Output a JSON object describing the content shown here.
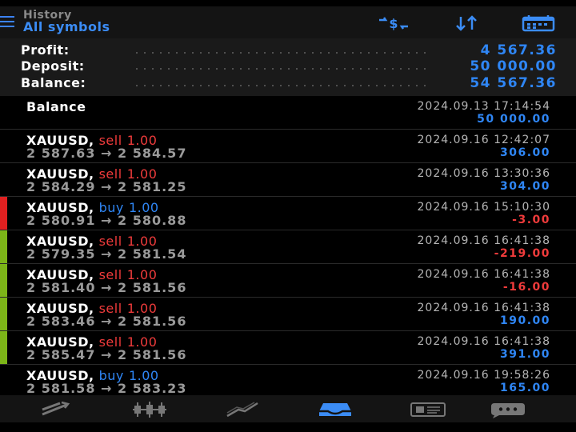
{
  "header": {
    "title": "History",
    "subtitle": "All symbols",
    "icons": [
      "menu-icon",
      "currency-exchange-icon",
      "sort-icon",
      "calendar-icon"
    ]
  },
  "summary": {
    "profit_label": "Profit:",
    "profit_value": "4 567.36",
    "deposit_label": "Deposit:",
    "deposit_value": "50 000.00",
    "balance_label": "Balance:",
    "balance_value": "54 567.36"
  },
  "deals": [
    {
      "symbol": "Balance",
      "side": "",
      "volume": "",
      "open": "",
      "close": "",
      "time": "2024.09.13 17:14:54",
      "amount": "50 000.00",
      "sign": "pos",
      "marker": ""
    },
    {
      "symbol": "XAUUSD,",
      "side": "sell",
      "volume": "1.00",
      "open": "2 587.63",
      "close": "2 584.57",
      "time": "2024.09.16 12:42:07",
      "amount": "306.00",
      "sign": "pos",
      "marker": ""
    },
    {
      "symbol": "XAUUSD,",
      "side": "sell",
      "volume": "1.00",
      "open": "2 584.29",
      "close": "2 581.25",
      "time": "2024.09.16 13:30:36",
      "amount": "304.00",
      "sign": "pos",
      "marker": ""
    },
    {
      "symbol": "XAUUSD,",
      "side": "buy",
      "volume": "1.00",
      "open": "2 580.91",
      "close": "2 580.88",
      "time": "2024.09.16 15:10:30",
      "amount": "-3.00",
      "sign": "neg",
      "marker": "#e02020"
    },
    {
      "symbol": "XAUUSD,",
      "side": "sell",
      "volume": "1.00",
      "open": "2 579.35",
      "close": "2 581.54",
      "time": "2024.09.16 16:41:38",
      "amount": "-219.00",
      "sign": "neg",
      "marker": "#7cb518"
    },
    {
      "symbol": "XAUUSD,",
      "side": "sell",
      "volume": "1.00",
      "open": "2 581.40",
      "close": "2 581.56",
      "time": "2024.09.16 16:41:38",
      "amount": "-16.00",
      "sign": "neg",
      "marker": "#7cb518"
    },
    {
      "symbol": "XAUUSD,",
      "side": "sell",
      "volume": "1.00",
      "open": "2 583.46",
      "close": "2 581.56",
      "time": "2024.09.16 16:41:38",
      "amount": "190.00",
      "sign": "pos",
      "marker": "#7cb518"
    },
    {
      "symbol": "XAUUSD,",
      "side": "sell",
      "volume": "1.00",
      "open": "2 585.47",
      "close": "2 581.56",
      "time": "2024.09.16 16:41:38",
      "amount": "391.00",
      "sign": "pos",
      "marker": "#7cb518"
    },
    {
      "symbol": "XAUUSD,",
      "side": "buy",
      "volume": "1.00",
      "open": "2 581.58",
      "close": "2 583.23",
      "time": "2024.09.16 19:58:26",
      "amount": "165.00",
      "sign": "pos",
      "marker": ""
    }
  ],
  "nav": {
    "items": [
      "quotes-icon",
      "chart-icon",
      "trade-icon",
      "history-icon",
      "news-icon",
      "messages-icon"
    ],
    "active": "history-icon"
  },
  "colors": {
    "accent": "#2f86f5",
    "sell": "#ef3b3b",
    "buy": "#2f86f5",
    "negative": "#ef3b3b",
    "marker_loss": "#e02020",
    "marker_group": "#7cb518"
  }
}
